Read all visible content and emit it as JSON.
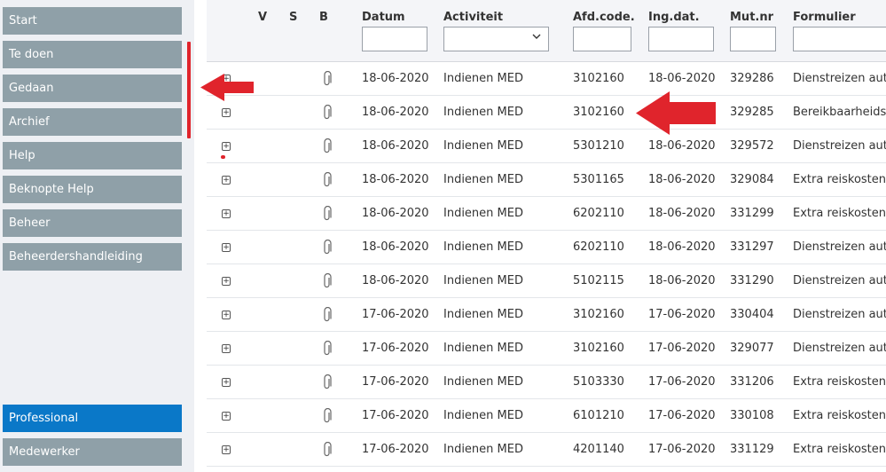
{
  "sidebar": {
    "items": [
      {
        "label": "Start"
      },
      {
        "label": "Te doen"
      },
      {
        "label": "Gedaan"
      },
      {
        "label": "Archief"
      },
      {
        "label": "Help"
      },
      {
        "label": "Beknopte Help"
      },
      {
        "label": "Beheer"
      },
      {
        "label": "Beheerdershandleiding"
      }
    ],
    "roles": [
      {
        "label": "Professional",
        "active": true
      },
      {
        "label": "Medewerker",
        "active": false
      }
    ]
  },
  "table": {
    "columns": {
      "v": "V",
      "s": "S",
      "b": "B",
      "datum": "Datum",
      "activiteit": "Activiteit",
      "afdcode": "Afd.code.",
      "ingdat": "Ing.dat.",
      "mutnr": "Mut.nr",
      "formulier": "Formulier"
    },
    "filters": {
      "datum": "",
      "activiteit": "",
      "afdcode": "",
      "ingdat": "",
      "mutnr": "",
      "formulier": ""
    },
    "rows": [
      {
        "datum": "18-06-2020",
        "activiteit": "Indienen MED",
        "afdcode": "3102160",
        "ingdat": "18-06-2020",
        "mutnr": "329286",
        "formulier": "Dienstreizen auto"
      },
      {
        "datum": "18-06-2020",
        "activiteit": "Indienen MED",
        "afdcode": "3102160",
        "ingdat": "",
        "mutnr": "329285",
        "formulier": "Bereikbaarheids d"
      },
      {
        "datum": "18-06-2020",
        "activiteit": "Indienen MED",
        "afdcode": "5301210",
        "ingdat": "18-06-2020",
        "mutnr": "329572",
        "formulier": "Dienstreizen auto"
      },
      {
        "datum": "18-06-2020",
        "activiteit": "Indienen MED",
        "afdcode": "5301165",
        "ingdat": "18-06-2020",
        "mutnr": "329084",
        "formulier": "Extra reiskosten w"
      },
      {
        "datum": "18-06-2020",
        "activiteit": "Indienen MED",
        "afdcode": "6202110",
        "ingdat": "18-06-2020",
        "mutnr": "331299",
        "formulier": "Extra reiskosten w"
      },
      {
        "datum": "18-06-2020",
        "activiteit": "Indienen MED",
        "afdcode": "6202110",
        "ingdat": "18-06-2020",
        "mutnr": "331297",
        "formulier": "Dienstreizen auto"
      },
      {
        "datum": "18-06-2020",
        "activiteit": "Indienen MED",
        "afdcode": "5102115",
        "ingdat": "18-06-2020",
        "mutnr": "331290",
        "formulier": "Dienstreizen auto"
      },
      {
        "datum": "17-06-2020",
        "activiteit": "Indienen MED",
        "afdcode": "3102160",
        "ingdat": "17-06-2020",
        "mutnr": "330404",
        "formulier": "Dienstreizen auto"
      },
      {
        "datum": "17-06-2020",
        "activiteit": "Indienen MED",
        "afdcode": "3102160",
        "ingdat": "17-06-2020",
        "mutnr": "329077",
        "formulier": "Dienstreizen auto"
      },
      {
        "datum": "17-06-2020",
        "activiteit": "Indienen MED",
        "afdcode": "5103330",
        "ingdat": "17-06-2020",
        "mutnr": "331206",
        "formulier": "Extra reiskosten w"
      },
      {
        "datum": "17-06-2020",
        "activiteit": "Indienen MED",
        "afdcode": "6101210",
        "ingdat": "17-06-2020",
        "mutnr": "330108",
        "formulier": "Extra reiskosten w"
      },
      {
        "datum": "17-06-2020",
        "activiteit": "Indienen MED",
        "afdcode": "4201140",
        "ingdat": "17-06-2020",
        "mutnr": "331129",
        "formulier": "Extra reiskosten w"
      }
    ]
  },
  "icons": {
    "expand": "expand-plus-icon",
    "attachment": "paperclip-icon",
    "dropdown": "chevron-down-icon",
    "annotation": "red-arrow-icon"
  },
  "colors": {
    "nav": "#8fa0a8",
    "active": "#0a78c8",
    "annotation": "#e0242c"
  }
}
